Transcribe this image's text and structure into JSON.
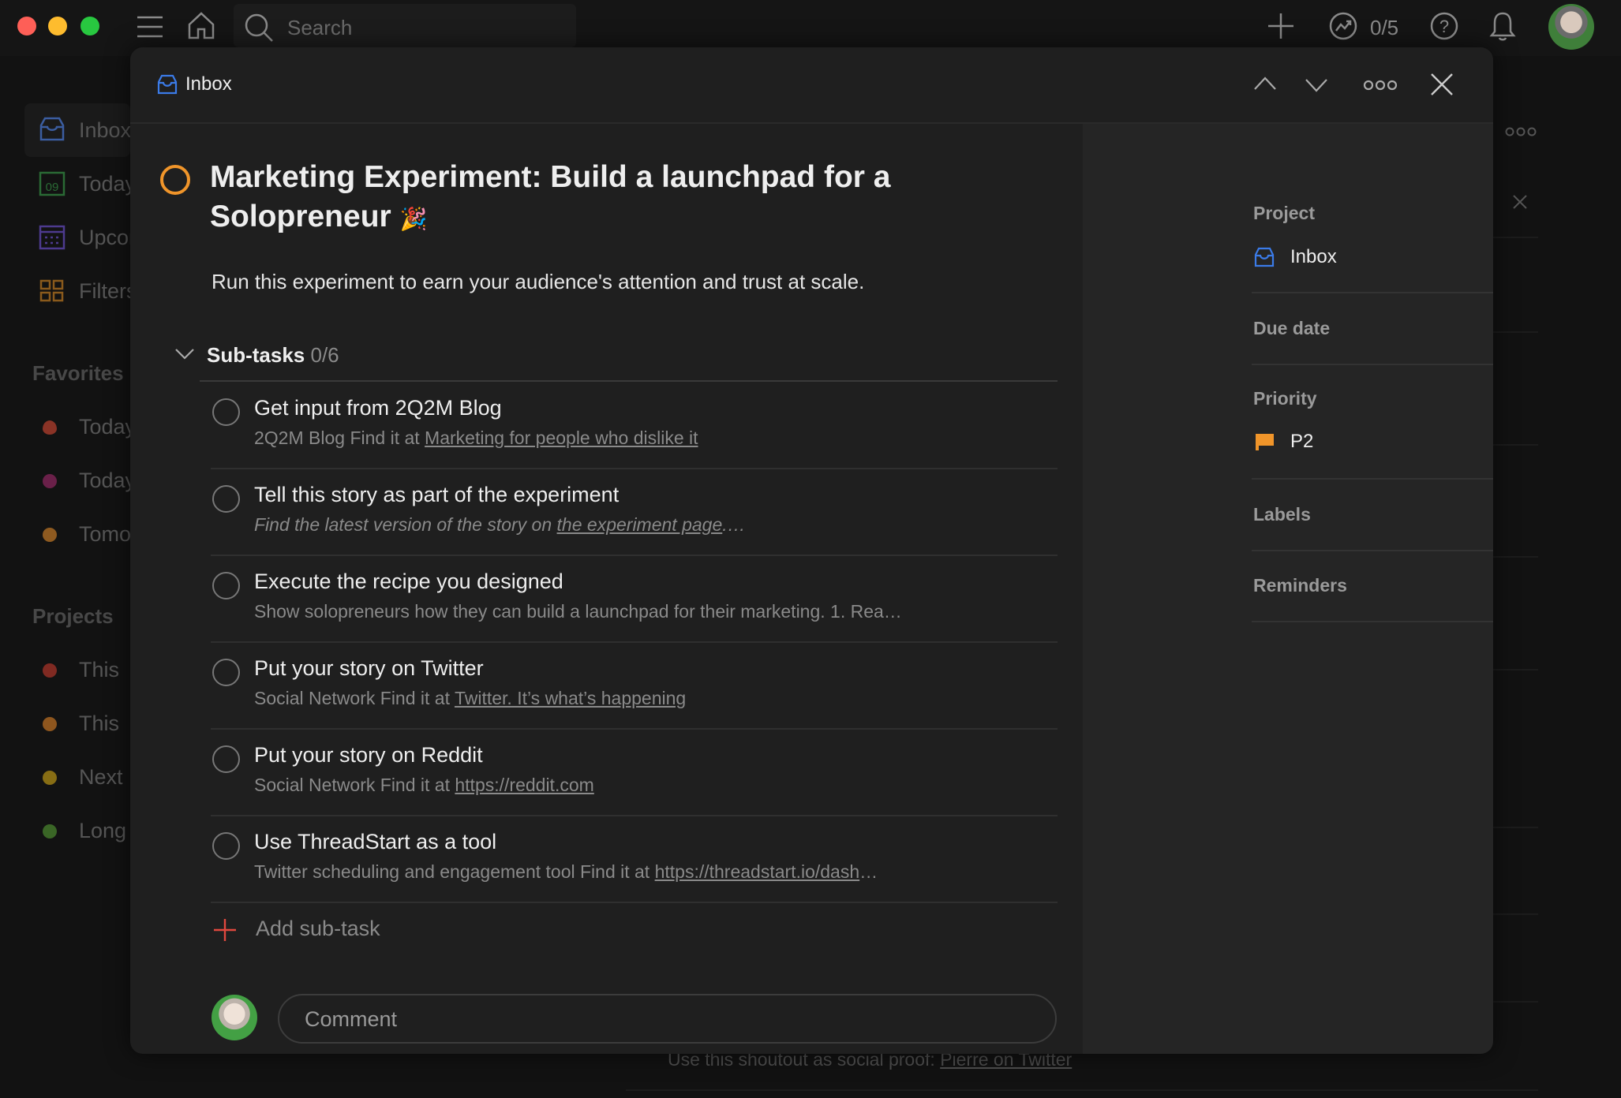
{
  "topbar": {
    "search_placeholder": "Search",
    "karma": "0/5"
  },
  "sidebar": {
    "nav": [
      {
        "label": "Inbox",
        "icon": "inbox-icon",
        "color": "#3b6fd4"
      },
      {
        "label": "Today",
        "icon": "calendar-today-icon",
        "color": "#2f8a3e"
      },
      {
        "label": "Upcoming",
        "icon": "calendar-upcoming-icon",
        "color": "#6a4fc4"
      },
      {
        "label": "Filters & Labels",
        "icon": "filters-icon",
        "color": "#c27a20"
      }
    ],
    "favorites_heading": "Favorites",
    "favorites": [
      {
        "label": "Today",
        "color": "#b8402f"
      },
      {
        "label": "Today",
        "color": "#8a2a60"
      },
      {
        "label": "Tomorrow",
        "color": "#c27a2a"
      }
    ],
    "projects_heading": "Projects",
    "projects": [
      {
        "label": "This",
        "color": "#b0392e"
      },
      {
        "label": "This",
        "color": "#c47428"
      },
      {
        "label": "Next",
        "color": "#b8961c"
      },
      {
        "label": "Long",
        "color": "#4f8a34"
      }
    ]
  },
  "background": {
    "shoutout_text": "Use this shoutout as social proof: ",
    "shoutout_link": "Pierre on Twitter"
  },
  "modal": {
    "breadcrumb": "Inbox",
    "task": {
      "title": "Marketing Experiment: Build a launchpad for a Solopreneur",
      "emoji": "🎉",
      "description": "Run this experiment to earn your audience's attention and trust at scale.",
      "priority_color": "#f0952a"
    },
    "subtasks": {
      "label": "Sub-tasks",
      "count": "0/6",
      "items": [
        {
          "title": "Get input from 2Q2M Blog",
          "desc": "2Q2M Blog Find it at ",
          "link": "Marketing for people who dislike it",
          "after": "",
          "italic": false
        },
        {
          "title": "Tell this story as part of the experiment",
          "desc": "Find the latest version of the story on ",
          "link": "the experiment page",
          "after": ".…",
          "italic": true
        },
        {
          "title": "Execute the recipe you designed",
          "desc": "Show solopreneurs how they can build a launchpad for their marketing. 1. Rea…",
          "link": "",
          "after": "",
          "italic": false
        },
        {
          "title": "Put your story on Twitter",
          "desc": "Social Network Find it at ",
          "link": "Twitter. It’s what’s happening",
          "after": "",
          "italic": false
        },
        {
          "title": "Put your story on Reddit",
          "desc": "Social Network Find it at ",
          "link": "https://reddit.com",
          "after": "",
          "italic": false
        },
        {
          "title": "Use ThreadStart as a tool",
          "desc": "Twitter scheduling and engagement tool Find it at ",
          "link": "https://threadstart.io/dash",
          "after": "…",
          "italic": false
        }
      ],
      "add_label": "Add sub-task"
    },
    "comment_placeholder": "Comment",
    "details": {
      "project_label": "Project",
      "project_value": "Inbox",
      "due_label": "Due date",
      "priority_label": "Priority",
      "priority_value": "P2",
      "priority_flag_color": "#f0952a",
      "labels_label": "Labels",
      "reminders_label": "Reminders"
    }
  }
}
